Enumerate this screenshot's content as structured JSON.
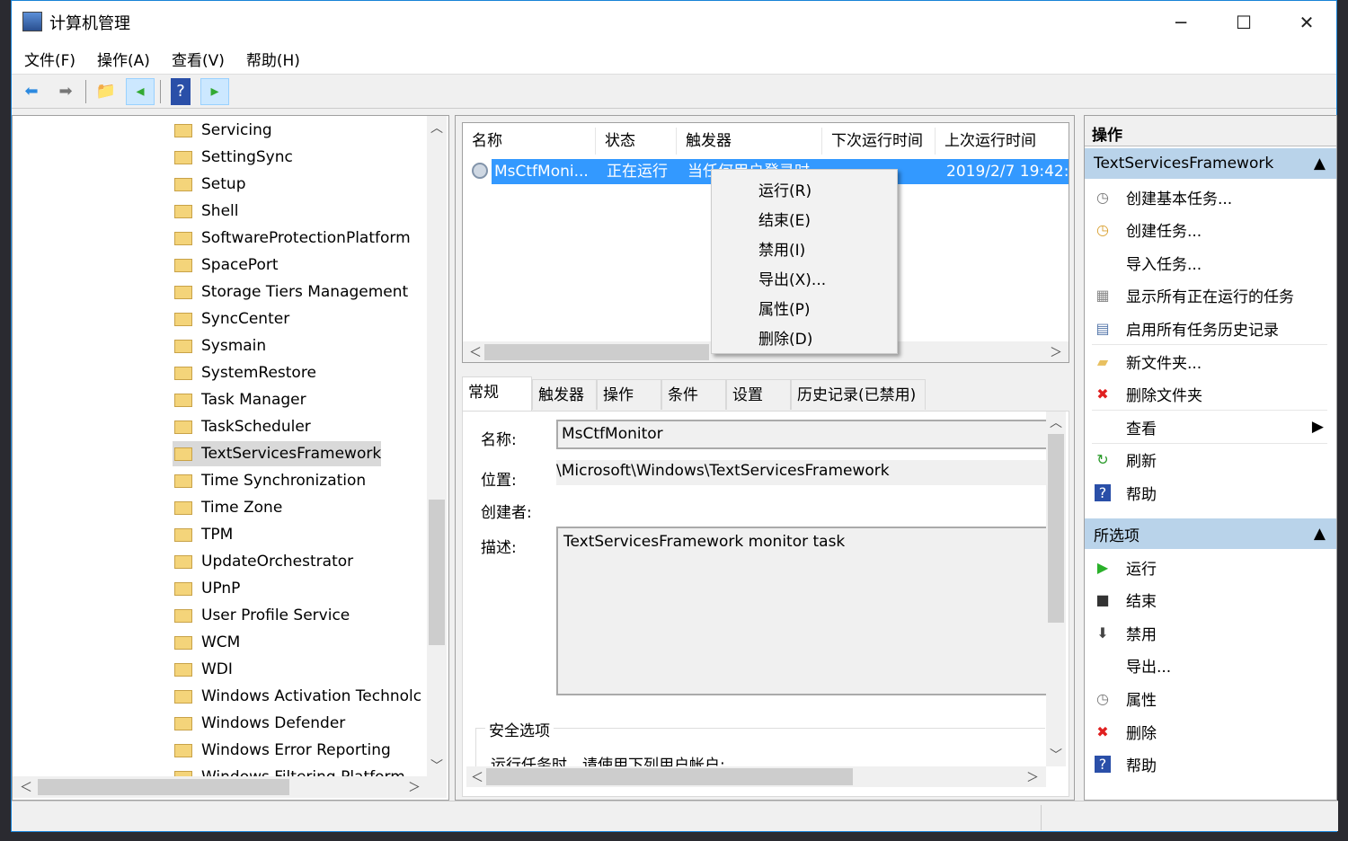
{
  "window": {
    "title": "计算机管理",
    "minimize": "─",
    "maximize": "☐",
    "close": "✕"
  },
  "menu": [
    "文件(F)",
    "操作(A)",
    "查看(V)",
    "帮助(H)"
  ],
  "toolbar": {
    "icons": [
      "back-arrow-icon",
      "forward-arrow-icon",
      "up-folder-icon",
      "show-hide-tree-icon",
      "help-icon",
      "show-hide-action-pane-icon"
    ]
  },
  "tree": {
    "items": [
      "Servicing",
      "SettingSync",
      "Setup",
      "Shell",
      "SoftwareProtectionPlatform",
      "SpacePort",
      "Storage Tiers Management",
      "SyncCenter",
      "Sysmain",
      "SystemRestore",
      "Task Manager",
      "TaskScheduler",
      "TextServicesFramework",
      "Time Synchronization",
      "Time Zone",
      "TPM",
      "UpdateOrchestrator",
      "UPnP",
      "User Profile Service",
      "WCM",
      "WDI",
      "Windows Activation Technolc",
      "Windows Defender",
      "Windows Error Reporting",
      "Windows Filtering Platform"
    ],
    "selected": "TextServicesFramework"
  },
  "tasklist": {
    "columns": [
      "名称",
      "状态",
      "触发器",
      "下次运行时间",
      "上次运行时间"
    ],
    "rows": [
      {
        "name": "MsCtfMoni...",
        "status": "正在运行",
        "trigger": "当任何用户登录时",
        "next": "",
        "last": "2019/2/7 19:42:"
      }
    ]
  },
  "context_menu": [
    "运行(R)",
    "结束(E)",
    "禁用(I)",
    "导出(X)...",
    "属性(P)",
    "删除(D)"
  ],
  "details": {
    "tabs": [
      "常规",
      "触发器",
      "操作",
      "条件",
      "设置",
      "历史记录(已禁用)"
    ],
    "name_label": "名称:",
    "name_value": "MsCtfMonitor",
    "location_label": "位置:",
    "location_value": "\\Microsoft\\Windows\\TextServicesFramework",
    "author_label": "创建者:",
    "desc_label": "描述:",
    "desc_value": "TextServicesFramework monitor task",
    "security_group": "安全选项",
    "security_text": "运行任务时，请使用下列用户帐户:"
  },
  "actions": {
    "header": "操作",
    "section1": "TextServicesFramework",
    "items1": [
      {
        "label": "创建基本任务...",
        "icon": "create-basic-task-icon"
      },
      {
        "label": "创建任务...",
        "icon": "create-task-icon"
      },
      {
        "label": "导入任务...",
        "icon": ""
      },
      {
        "label": "显示所有正在运行的任务",
        "icon": "running-tasks-icon"
      },
      {
        "label": "启用所有任务历史记录",
        "icon": "history-icon"
      },
      {
        "label": "新文件夹...",
        "icon": "new-folder-icon"
      },
      {
        "label": "删除文件夹",
        "icon": "delete-icon"
      },
      {
        "label": "查看",
        "icon": ""
      },
      {
        "label": "刷新",
        "icon": "refresh-icon"
      },
      {
        "label": "帮助",
        "icon": "help-icon"
      }
    ],
    "section2": "所选项",
    "items2": [
      {
        "label": "运行",
        "icon": "run-icon"
      },
      {
        "label": "结束",
        "icon": "stop-icon"
      },
      {
        "label": "禁用",
        "icon": "disable-icon"
      },
      {
        "label": "导出...",
        "icon": ""
      },
      {
        "label": "属性",
        "icon": "properties-icon"
      },
      {
        "label": "删除",
        "icon": "delete-icon"
      },
      {
        "label": "帮助",
        "icon": "help-icon"
      }
    ]
  },
  "colors": {
    "selection": "#3399ff",
    "section_header": "#b9d3ea",
    "window_border": "#1883d7"
  }
}
